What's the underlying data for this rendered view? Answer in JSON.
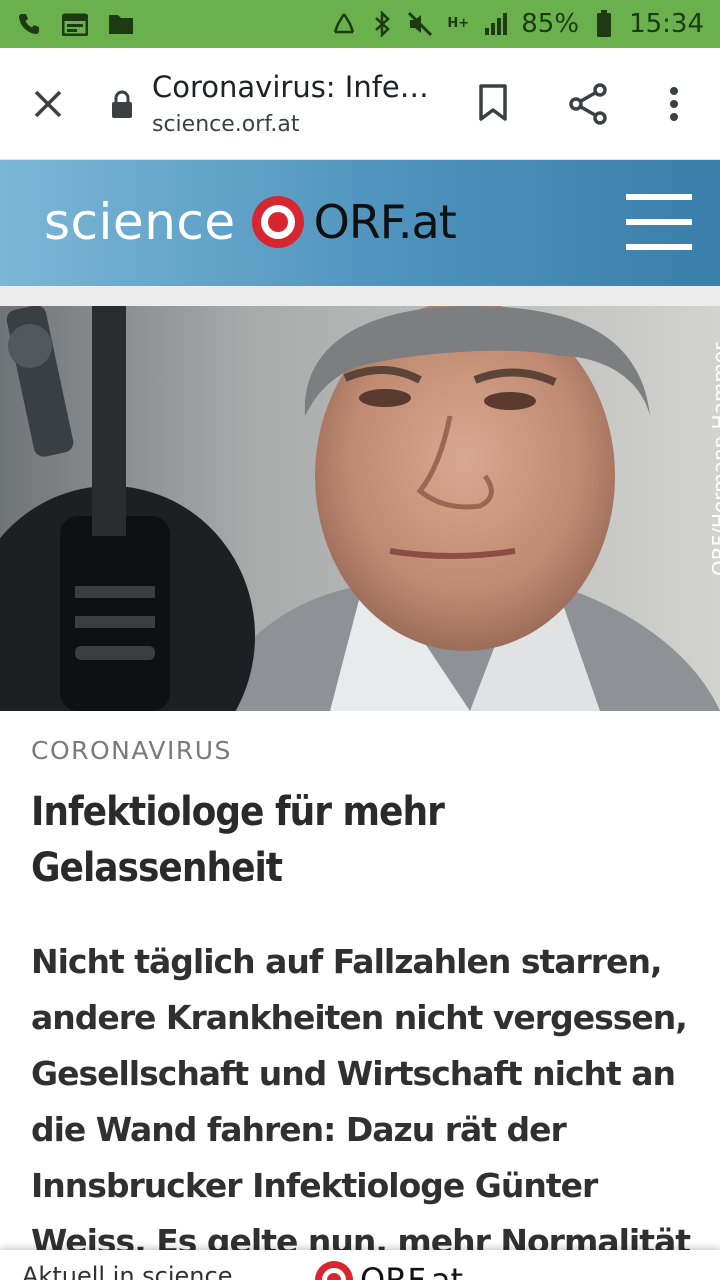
{
  "status_bar": {
    "icons_left": [
      "phone-icon",
      "calendar-icon",
      "folder-icon"
    ],
    "icons_right": [
      "recycle-icon",
      "bluetooth-icon",
      "mute-icon",
      "hplus-signal-icon",
      "signal-icon",
      "battery-icon"
    ],
    "network": "H+",
    "battery": "85%",
    "time": "15:34"
  },
  "browser": {
    "title": "Coronavirus: Infektiologe für mehr Gelassenheit",
    "url": "science.orf.at"
  },
  "site_header": {
    "logo_science": "science",
    "logo_orf": "ORF.at"
  },
  "hero": {
    "credit": "ORF/Hermann Hammer"
  },
  "article": {
    "kicker": "CORONAVIRUS",
    "headline": "Infektiologe für mehr Gelassenheit",
    "lead": "Nicht täglich auf Fallzahlen starren, andere Krankheiten nicht vergessen, Gesellschaft und Wirtschaft nicht an die Wand fahren: Dazu rät der Innsbrucker Infektiologe Günter Weiss. Es gelte nun, mehr Normalität zu wagen und von"
  },
  "bottom_bar": {
    "text": "Aktuell in science",
    "logo": "ORF.at"
  },
  "colors": {
    "status_bar": "#6ab04c",
    "orf_red": "#d7262f",
    "header_blue": "#4e93bd"
  }
}
